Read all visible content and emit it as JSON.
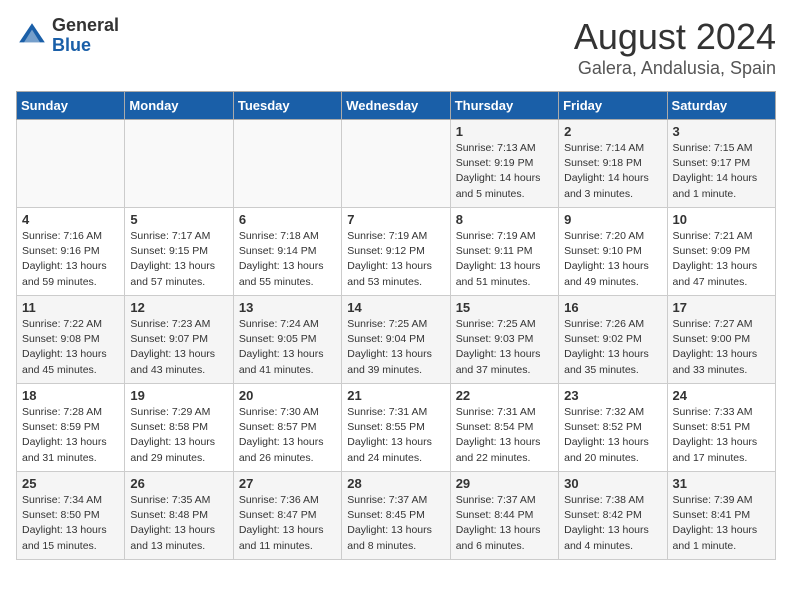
{
  "logo": {
    "general": "General",
    "blue": "Blue"
  },
  "title": "August 2024",
  "subtitle": "Galera, Andalusia, Spain",
  "days_of_week": [
    "Sunday",
    "Monday",
    "Tuesday",
    "Wednesday",
    "Thursday",
    "Friday",
    "Saturday"
  ],
  "weeks": [
    [
      {
        "day": "",
        "info": ""
      },
      {
        "day": "",
        "info": ""
      },
      {
        "day": "",
        "info": ""
      },
      {
        "day": "",
        "info": ""
      },
      {
        "day": "1",
        "info": "Sunrise: 7:13 AM\nSunset: 9:19 PM\nDaylight: 14 hours\nand 5 minutes."
      },
      {
        "day": "2",
        "info": "Sunrise: 7:14 AM\nSunset: 9:18 PM\nDaylight: 14 hours\nand 3 minutes."
      },
      {
        "day": "3",
        "info": "Sunrise: 7:15 AM\nSunset: 9:17 PM\nDaylight: 14 hours\nand 1 minute."
      }
    ],
    [
      {
        "day": "4",
        "info": "Sunrise: 7:16 AM\nSunset: 9:16 PM\nDaylight: 13 hours\nand 59 minutes."
      },
      {
        "day": "5",
        "info": "Sunrise: 7:17 AM\nSunset: 9:15 PM\nDaylight: 13 hours\nand 57 minutes."
      },
      {
        "day": "6",
        "info": "Sunrise: 7:18 AM\nSunset: 9:14 PM\nDaylight: 13 hours\nand 55 minutes."
      },
      {
        "day": "7",
        "info": "Sunrise: 7:19 AM\nSunset: 9:12 PM\nDaylight: 13 hours\nand 53 minutes."
      },
      {
        "day": "8",
        "info": "Sunrise: 7:19 AM\nSunset: 9:11 PM\nDaylight: 13 hours\nand 51 minutes."
      },
      {
        "day": "9",
        "info": "Sunrise: 7:20 AM\nSunset: 9:10 PM\nDaylight: 13 hours\nand 49 minutes."
      },
      {
        "day": "10",
        "info": "Sunrise: 7:21 AM\nSunset: 9:09 PM\nDaylight: 13 hours\nand 47 minutes."
      }
    ],
    [
      {
        "day": "11",
        "info": "Sunrise: 7:22 AM\nSunset: 9:08 PM\nDaylight: 13 hours\nand 45 minutes."
      },
      {
        "day": "12",
        "info": "Sunrise: 7:23 AM\nSunset: 9:07 PM\nDaylight: 13 hours\nand 43 minutes."
      },
      {
        "day": "13",
        "info": "Sunrise: 7:24 AM\nSunset: 9:05 PM\nDaylight: 13 hours\nand 41 minutes."
      },
      {
        "day": "14",
        "info": "Sunrise: 7:25 AM\nSunset: 9:04 PM\nDaylight: 13 hours\nand 39 minutes."
      },
      {
        "day": "15",
        "info": "Sunrise: 7:25 AM\nSunset: 9:03 PM\nDaylight: 13 hours\nand 37 minutes."
      },
      {
        "day": "16",
        "info": "Sunrise: 7:26 AM\nSunset: 9:02 PM\nDaylight: 13 hours\nand 35 minutes."
      },
      {
        "day": "17",
        "info": "Sunrise: 7:27 AM\nSunset: 9:00 PM\nDaylight: 13 hours\nand 33 minutes."
      }
    ],
    [
      {
        "day": "18",
        "info": "Sunrise: 7:28 AM\nSunset: 8:59 PM\nDaylight: 13 hours\nand 31 minutes."
      },
      {
        "day": "19",
        "info": "Sunrise: 7:29 AM\nSunset: 8:58 PM\nDaylight: 13 hours\nand 29 minutes."
      },
      {
        "day": "20",
        "info": "Sunrise: 7:30 AM\nSunset: 8:57 PM\nDaylight: 13 hours\nand 26 minutes."
      },
      {
        "day": "21",
        "info": "Sunrise: 7:31 AM\nSunset: 8:55 PM\nDaylight: 13 hours\nand 24 minutes."
      },
      {
        "day": "22",
        "info": "Sunrise: 7:31 AM\nSunset: 8:54 PM\nDaylight: 13 hours\nand 22 minutes."
      },
      {
        "day": "23",
        "info": "Sunrise: 7:32 AM\nSunset: 8:52 PM\nDaylight: 13 hours\nand 20 minutes."
      },
      {
        "day": "24",
        "info": "Sunrise: 7:33 AM\nSunset: 8:51 PM\nDaylight: 13 hours\nand 17 minutes."
      }
    ],
    [
      {
        "day": "25",
        "info": "Sunrise: 7:34 AM\nSunset: 8:50 PM\nDaylight: 13 hours\nand 15 minutes."
      },
      {
        "day": "26",
        "info": "Sunrise: 7:35 AM\nSunset: 8:48 PM\nDaylight: 13 hours\nand 13 minutes."
      },
      {
        "day": "27",
        "info": "Sunrise: 7:36 AM\nSunset: 8:47 PM\nDaylight: 13 hours\nand 11 minutes."
      },
      {
        "day": "28",
        "info": "Sunrise: 7:37 AM\nSunset: 8:45 PM\nDaylight: 13 hours\nand 8 minutes."
      },
      {
        "day": "29",
        "info": "Sunrise: 7:37 AM\nSunset: 8:44 PM\nDaylight: 13 hours\nand 6 minutes."
      },
      {
        "day": "30",
        "info": "Sunrise: 7:38 AM\nSunset: 8:42 PM\nDaylight: 13 hours\nand 4 minutes."
      },
      {
        "day": "31",
        "info": "Sunrise: 7:39 AM\nSunset: 8:41 PM\nDaylight: 13 hours\nand 1 minute."
      }
    ]
  ]
}
